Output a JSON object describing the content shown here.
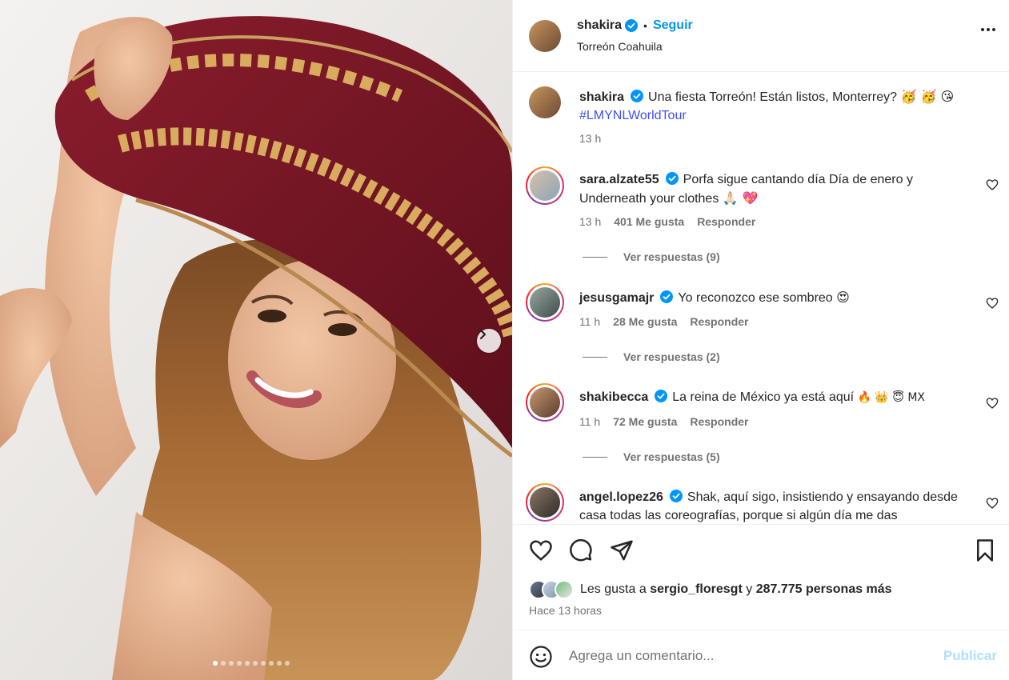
{
  "colors": {
    "accent": "#0095f6",
    "verified": "#0095f6",
    "hashtag": "#4150f7",
    "muted": "#737373",
    "publish_disabled": "#b2dffc"
  },
  "media": {
    "slides_total": 10,
    "current_slide": 1,
    "next_icon": "chevron-right-icon"
  },
  "header": {
    "username": "shakira",
    "separator": "•",
    "follow_label": "Seguir",
    "location": "Torreón Coahuila",
    "more_icon": "more-horizontal-icon"
  },
  "caption": {
    "username": "shakira",
    "text": "Una fiesta Torreón! Están listos, Monterrey?",
    "emojis": "🥳 🥳 😘",
    "hashtag": "#LMYNLWorldTour",
    "time": "13 h"
  },
  "comments": [
    {
      "username": "sara.alzate55",
      "text": "Porfa sigue cantando día Día de enero y Underneath your clothes",
      "emojis": "🙏🏻 💖",
      "time": "13 h",
      "likes": "401 Me gusta",
      "reply_label": "Responder",
      "replies_label": "Ver respuestas (9)"
    },
    {
      "username": "jesusgamajr",
      "text": "Yo reconozco ese sombreo",
      "emojis": "😍",
      "time": "11 h",
      "likes": "28 Me gusta",
      "reply_label": "Responder",
      "replies_label": "Ver respuestas (2)"
    },
    {
      "username": "shakibecca",
      "text": "La reina de México ya está aquí",
      "emojis": "🔥 👑 😇 MX",
      "time": "11 h",
      "likes": "72 Me gusta",
      "reply_label": "Responder",
      "replies_label": "Ver respuestas (5)"
    },
    {
      "username": "angel.lopez26",
      "text": "Shak, aquí sigo, insistiendo y ensayando desde casa todas las coreografías, porque si algún día me das"
    }
  ],
  "actions": {
    "like_icon": "heart-icon",
    "comment_icon": "comment-icon",
    "share_icon": "send-icon",
    "save_icon": "bookmark-icon",
    "likes_prefix": "Les gusta a",
    "likes_user": "sergio_floresgt",
    "likes_joiner": "y",
    "likes_others": "287.775 personas más",
    "time_ago": "Hace 13 horas"
  },
  "composer": {
    "emoji_icon": "smiley-icon",
    "placeholder": "Agrega un comentario...",
    "publish_label": "Publicar"
  }
}
